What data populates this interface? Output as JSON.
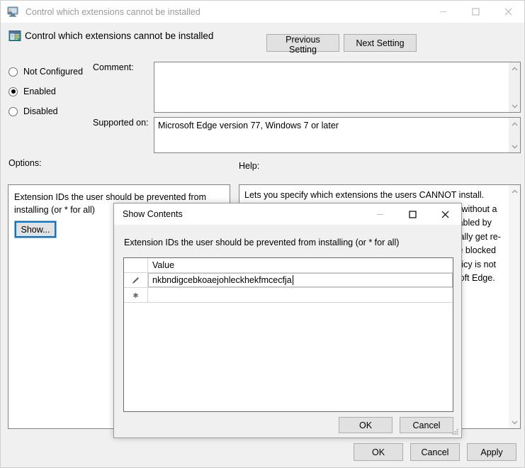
{
  "window": {
    "title": "Control which extensions cannot be installed",
    "title_icon": "policy-computer-icon",
    "controls": {
      "minimize": "minimize-icon",
      "maximize": "maximize-icon",
      "close": "close-icon"
    }
  },
  "header": {
    "icon": "policy-setting-icon",
    "title": "Control which extensions cannot be installed",
    "previous_setting": "Previous Setting",
    "next_setting": "Next Setting"
  },
  "state": {
    "options": [
      {
        "label": "Not Configured",
        "selected": false
      },
      {
        "label": "Enabled",
        "selected": true
      },
      {
        "label": "Disabled",
        "selected": false
      }
    ]
  },
  "comment": {
    "label": "Comment:",
    "value": "",
    "placeholder": ""
  },
  "supported_on": {
    "label": "Supported on:",
    "value": "Microsoft Edge version 77, Windows 7 or later"
  },
  "options_panel": {
    "label": "Options:",
    "description": "Extension IDs the user should be prevented from installing (or * for all)",
    "show_button": "Show..."
  },
  "help_panel": {
    "label": "Help:",
    "text": "Lets you specify which extensions the users CANNOT install. Extensions already installed will be disabled if blocked, without a way for the user to enable them. After an extension disabled by this policy is removed from its blocklist, it will automatically get re-enabled.\n\nA blocklist value of '*' means all extensions are blocked unless they are explicitly listed in the allowlist.\n\nIf this policy is not configured, the user can install any extension in Microsoft Edge."
  },
  "footer": {
    "ok": "OK",
    "cancel": "Cancel",
    "apply": "Apply"
  },
  "dialog": {
    "title": "Show Contents",
    "controls": {
      "minimize": "minimize-icon",
      "maximize": "maximize-icon",
      "close": "close-icon"
    },
    "description": "Extension IDs the user should be prevented from installing (or * for all)",
    "grid": {
      "columns": [
        "Value"
      ],
      "rows": [
        {
          "row_icon": "pencil-edit-icon",
          "value": "nkbndigcebkoaejohleckhekfmcecfja",
          "editing": true
        },
        {
          "row_icon": "new-row-asterisk-icon",
          "value": "",
          "editing": false
        }
      ]
    },
    "ok": "OK",
    "cancel": "Cancel",
    "resize_grip": "resize-grip-icon"
  }
}
